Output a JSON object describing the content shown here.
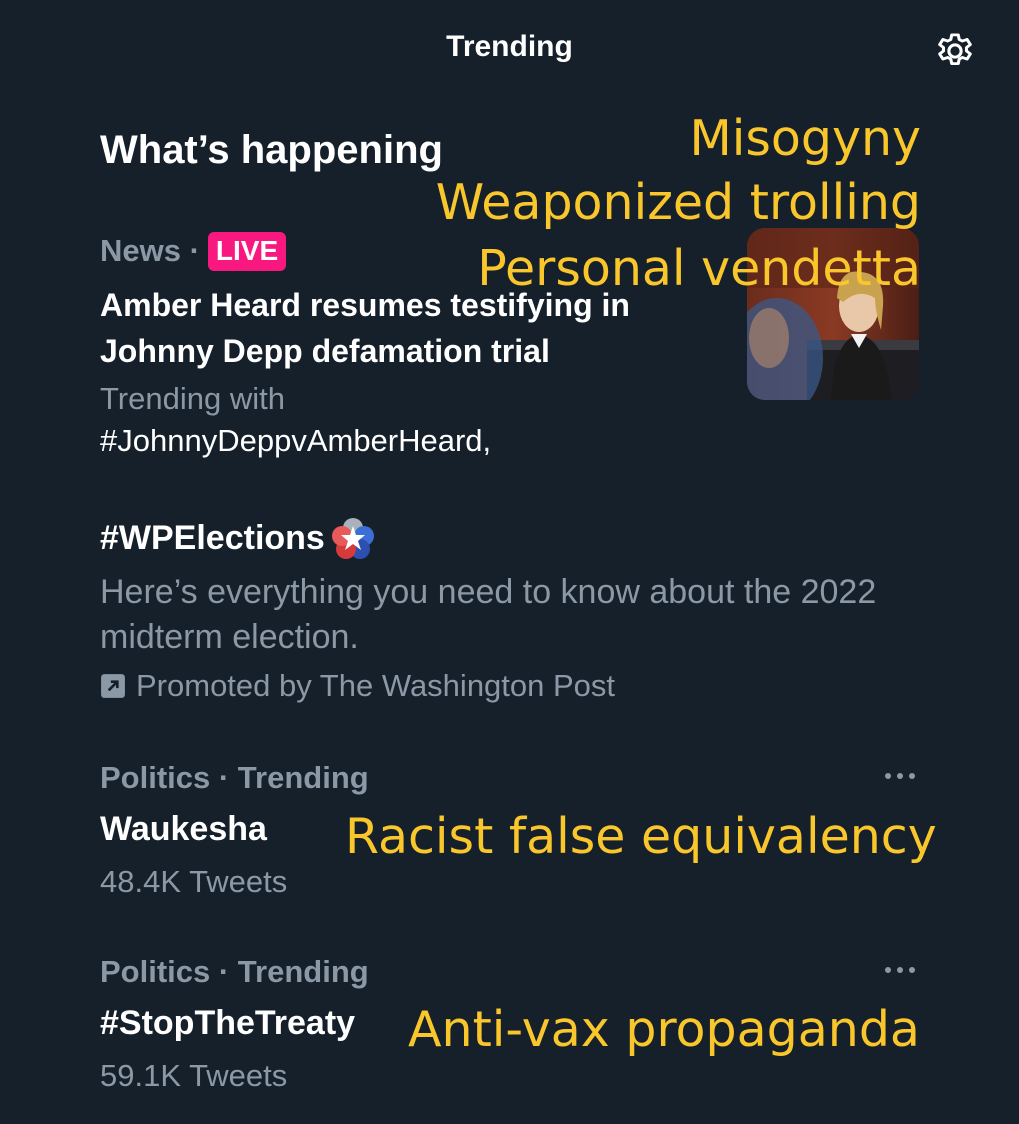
{
  "header": {
    "title": "Trending"
  },
  "section_title": "What’s happening",
  "news": {
    "category": "News ·",
    "badge": "LIVE",
    "headline": "Amber Heard resumes testifying in Johnny Depp defamation trial",
    "trending_with_label": "Trending with",
    "hashtag": "#JohnnyDeppvAmberHeard,"
  },
  "promoted": {
    "title": "#WPElections",
    "description": "Here’s everything you need to know about the 2022 midterm election.",
    "promoted_by": "Promoted by The Washington Post"
  },
  "trends": [
    {
      "meta": "Politics · Trending",
      "name": "Waukesha",
      "count": "48.4K Tweets"
    },
    {
      "meta": "Politics · Trending",
      "name": "#StopTheTreaty",
      "count": "59.1K Tweets"
    }
  ],
  "annotations": {
    "line1": "Misogyny",
    "line2": "Weaponized trolling",
    "line3": "Personal vendetta",
    "waukesha": "Racist false equivalency",
    "treaty": "Anti-vax propaganda"
  },
  "colors": {
    "background": "#15202b",
    "text_primary": "#ffffff",
    "text_secondary": "#8b98a5",
    "live_badge": "#f91880",
    "annotation": "#f9c62b"
  },
  "icons": {
    "settings": "gear-icon",
    "more": "more-icon",
    "promoted": "promoted-icon",
    "hashflag": "wp-elections-star-icon"
  }
}
